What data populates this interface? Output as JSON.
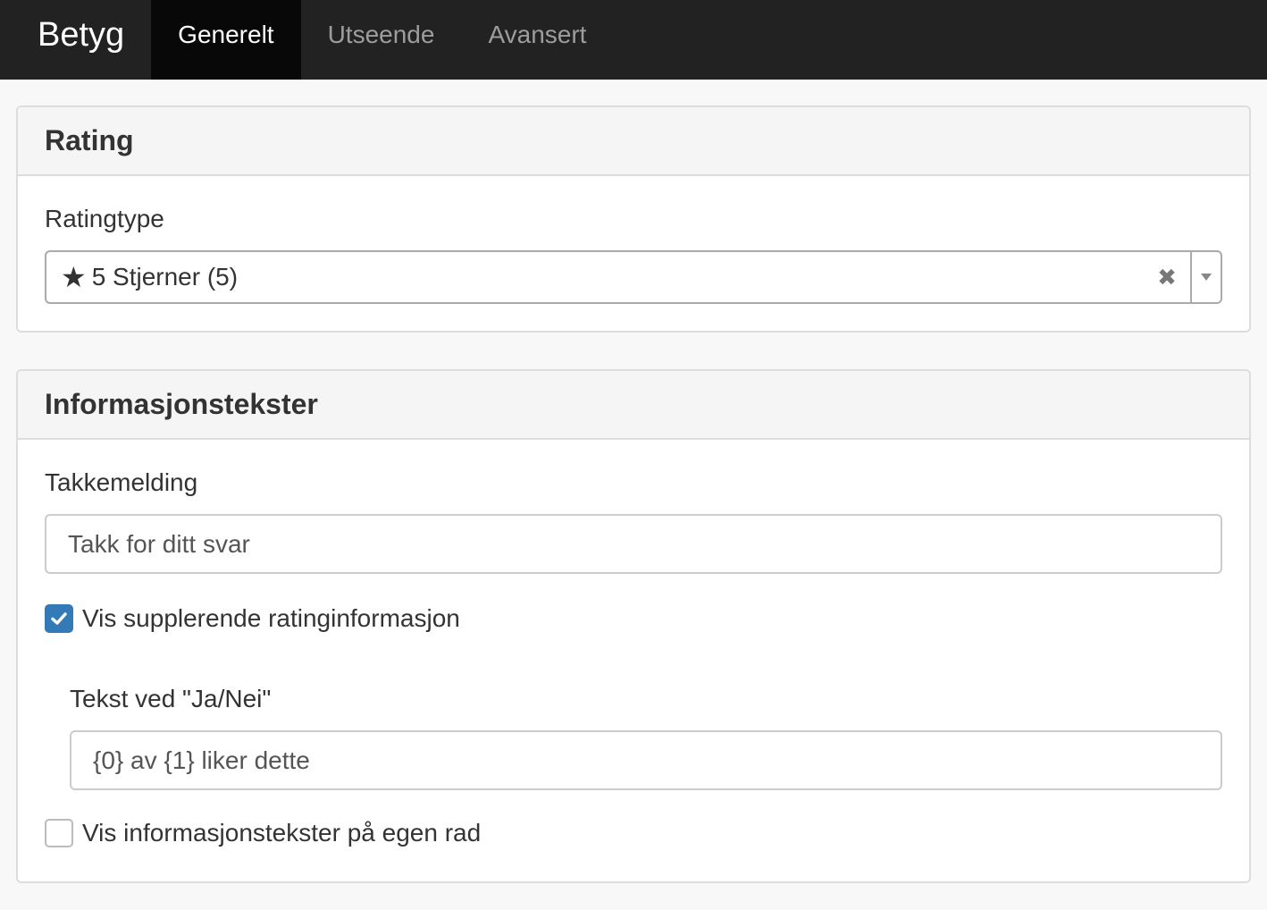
{
  "navbar": {
    "brand": "Betyg",
    "tabs": [
      {
        "label": "Generelt",
        "active": true
      },
      {
        "label": "Utseende",
        "active": false
      },
      {
        "label": "Avansert",
        "active": false
      }
    ]
  },
  "rating_panel": {
    "title": "Rating",
    "type_label": "Ratingtype",
    "type_select": {
      "icon": "star-icon",
      "icon_glyph": "★",
      "value": "5 Stjerner (5)",
      "clear_glyph": "✖"
    }
  },
  "info_panel": {
    "title": "Informasjonstekster",
    "thanks_label": "Takkemelding",
    "thanks_value": "Takk for ditt svar",
    "show_supplementary": {
      "label": "Vis supplerende ratinginformasjon",
      "checked": true
    },
    "yes_no_label": "Tekst ved \"Ja/Nei\"",
    "yes_no_value": "{0} av {1} liker dette",
    "own_row": {
      "label": "Vis informasjonstekster på egen rad",
      "checked": false
    }
  },
  "colors": {
    "navbar_bg": "#222222",
    "active_tab_bg": "#080808",
    "checkbox_checked": "#337ab7"
  }
}
